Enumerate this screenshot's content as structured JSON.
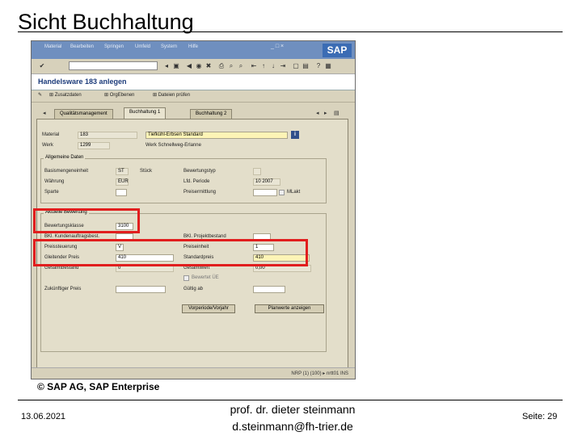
{
  "slide": {
    "title": "Sicht Buchhaltung",
    "copyright": "© SAP AG, SAP Enterprise",
    "date": "13.06.2021",
    "author_line1": "prof. dr. dieter steinmann",
    "author_line2": "d.steinmann@fh-trier.de",
    "page": "Seite: 29"
  },
  "sap": {
    "menu": [
      "Material",
      "Bearbeiten",
      "Springen",
      "Umfeld",
      "System",
      "Hilfe"
    ],
    "window_controls": "_ □ ×",
    "logo": "SAP",
    "screen_title": "Handelsware 183 anlegen",
    "appbar": [
      "Zusatzdaten",
      "OrgEbenen",
      "Dateien prüfen"
    ],
    "tabs": [
      "Qualitätsmanagement",
      "Buchhaltung 1",
      "Buchhaltung 2"
    ],
    "header": {
      "material_label": "Material",
      "material_value": "183",
      "material_desc": "Tiefkühl-Erbsen Standard",
      "werk_label": "Werk",
      "werk_value": "1299",
      "werk_desc": "Werk Schnellweg-Erlanne"
    },
    "general": {
      "title": "Allgemeine Daten",
      "basismenge_label": "Basismengeneinheit",
      "basismenge_value": "ST",
      "basismenge_unit": "Stück",
      "bewertungstyp_label": "Bewertungstyp",
      "bewertungstyp_value": "",
      "wahrung_label": "Währung",
      "wahrung_value": "EUR",
      "lfd_periode_label": "Lfd. Periode",
      "lfd_periode_value": "10 2007",
      "sparte_label": "Sparte",
      "sparte_value": "",
      "preisermittlung_label": "Preisermittlung",
      "preisermittlung_value": "",
      "mlakt_label": "MLakt"
    },
    "current": {
      "title": "Aktuelle Bewertung",
      "bewertungsklasse_label": "Bewertungsklasse",
      "bewertungsklasse_value": "3100",
      "bkl_kundenauftrag_label": "BKl. Kundenauftragsbest.",
      "bkl_kundenauftrag_value": "",
      "bkl_projektbestand_label": "BKl. Projektbestand",
      "bkl_projektbestand_value": "",
      "preissteuerung_label": "Preissteuerung",
      "preissteuerung_value": "V",
      "preiseinheit_label": "Preiseinheit",
      "preiseinheit_value": "1",
      "gleitender_label": "Gleitender Preis",
      "gleitender_value": "410",
      "standardpreis_label": "Standardpreis",
      "standardpreis_value": "410",
      "gesamtbestand_label": "Gesamtbestand",
      "gesamtbestand_value": "0",
      "gesamtwert_label": "Gesamtwert",
      "gesamtwert_value": "0,00",
      "bewertet_ue_label": "Bewertet ÜE",
      "zukuenftiger_label": "Zukünftiger Preis",
      "zukuenftiger_value": "",
      "gueltig_ab_label": "Gültig ab",
      "gueltig_ab_value": "",
      "btn_vorperiode": "Vorperiode/Vorjahr",
      "btn_planwerte": "Planwerte anzeigen"
    },
    "status": "NRP (1) (100) ▸  nrtt01  INS"
  },
  "colors": {
    "highlight": "#e11e1e",
    "sap_blue": "#3b6cb4",
    "menubar": "#6f8fbf"
  }
}
